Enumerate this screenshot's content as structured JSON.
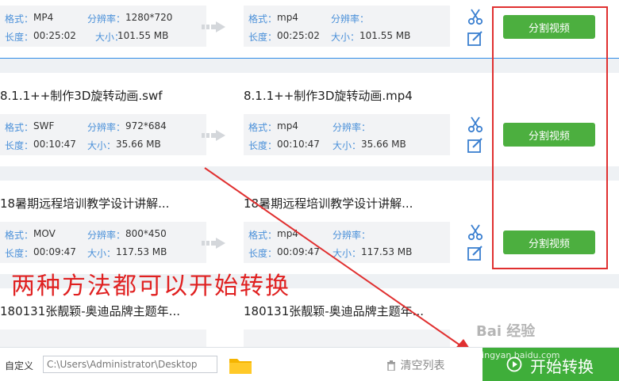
{
  "rows": [
    {
      "src_name": "",
      "dst_name": "",
      "src": {
        "format_label": "格式：",
        "format": "MP4",
        "res_label": "分辨率：",
        "res": "1280*720",
        "dur_label": "长度：",
        "dur": "00:25:02",
        "size_label": "大小：",
        "size": "101.55 MB"
      },
      "dst": {
        "format_label": "格式：",
        "format": "mp4",
        "res_label": "分辨率：",
        "res": "",
        "dur_label": "长度：",
        "dur": "00:25:02",
        "size_label": "大小：",
        "size": "101.55 MB"
      },
      "split_label": "分割视频"
    },
    {
      "src_name": "8.1.1++制作3D旋转动画.swf",
      "dst_name": "8.1.1++制作3D旋转动画.mp4",
      "src": {
        "format_label": "格式：",
        "format": "SWF",
        "res_label": "分辨率：",
        "res": "972*684",
        "dur_label": "长度：",
        "dur": "00:10:47",
        "size_label": "大小：",
        "size": "35.66 MB"
      },
      "dst": {
        "format_label": "格式：",
        "format": "mp4",
        "res_label": "分辨率：",
        "res": "",
        "dur_label": "长度：",
        "dur": "00:10:47",
        "size_label": "大小：",
        "size": "35.66 MB"
      },
      "split_label": "分割视频"
    },
    {
      "src_name": "18暑期远程培训教学设计讲解...",
      "dst_name": "18暑期远程培训教学设计讲解...",
      "src": {
        "format_label": "格式：",
        "format": "MOV",
        "res_label": "分辨率：",
        "res": "800*450",
        "dur_label": "长度：",
        "dur": "00:09:47",
        "size_label": "大小：",
        "size": "117.53 MB"
      },
      "dst": {
        "format_label": "格式：",
        "format": "mp4",
        "res_label": "分辨率：",
        "res": "",
        "dur_label": "长度：",
        "dur": "00:09:47",
        "size_label": "大小：",
        "size": "117.53 MB"
      },
      "split_label": "分割视频"
    },
    {
      "src_name": "180131张靓颖-奥迪品牌主题年...",
      "dst_name": "180131张靓颖-奥迪品牌主题年..."
    }
  ],
  "overlay_text": "两种方法都可以开始转换",
  "bottom": {
    "save_label": "自定义",
    "path": "C:\\Users\\Administrator\\Desktop",
    "clear_label": "清空列表",
    "start_label": "开始转换"
  },
  "watermark": "Bai 经验",
  "watermark_url": "jingyan.baidu.com",
  "colors": {
    "accent": "#2e8be6",
    "split_green": "#4caf3f",
    "start_green": "#3fae3a",
    "annotation_red": "#e03030",
    "label_blue": "#4a90d9"
  }
}
